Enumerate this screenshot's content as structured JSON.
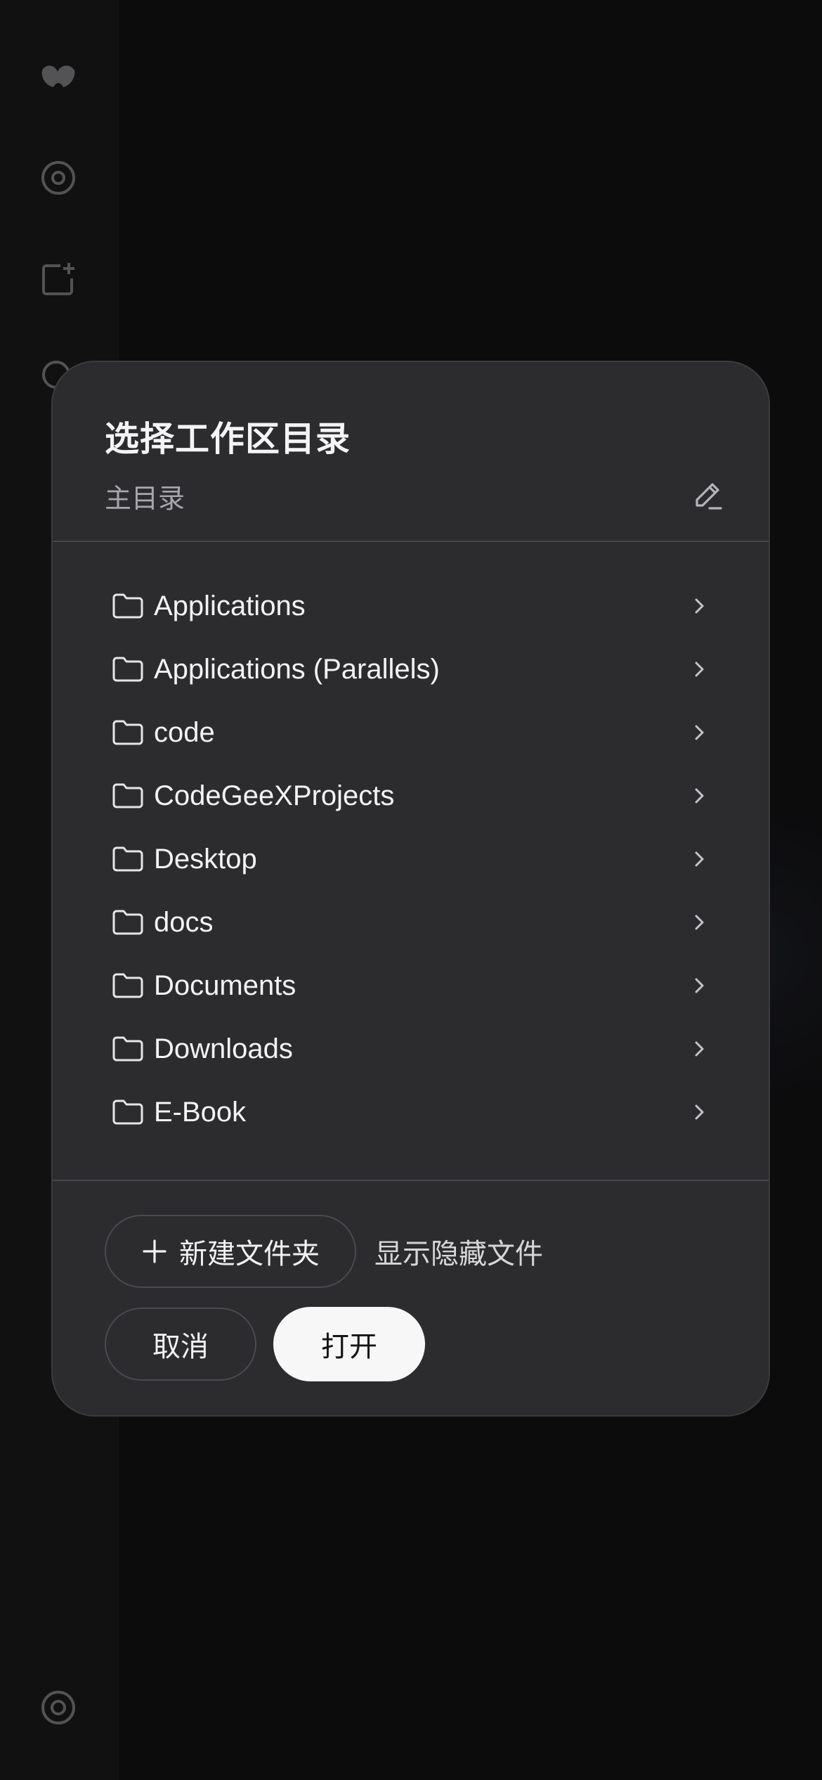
{
  "dialog": {
    "title": "选择工作区目录",
    "current_path": "主目录",
    "edit_icon": "pencil-edit-icon",
    "folders": [
      {
        "name": "Applications"
      },
      {
        "name": "Applications (Parallels)"
      },
      {
        "name": "code"
      },
      {
        "name": "CodeGeeXProjects"
      },
      {
        "name": "Desktop"
      },
      {
        "name": "docs"
      },
      {
        "name": "Documents"
      },
      {
        "name": "Downloads"
      },
      {
        "name": "E-Book"
      }
    ],
    "new_folder_label": "新建文件夹",
    "show_hidden_label": "显示隐藏文件",
    "cancel_label": "取消",
    "open_label": "打开"
  },
  "sidebar": {
    "icons": [
      "app-logo-icon",
      "search-icon",
      "new-chat-icon",
      "history-icon",
      "settings-icon"
    ]
  },
  "colors": {
    "modal_bg": "#2c2c2f",
    "primary_button_bg": "#f7f7f8",
    "background": "#0c0c0d"
  }
}
